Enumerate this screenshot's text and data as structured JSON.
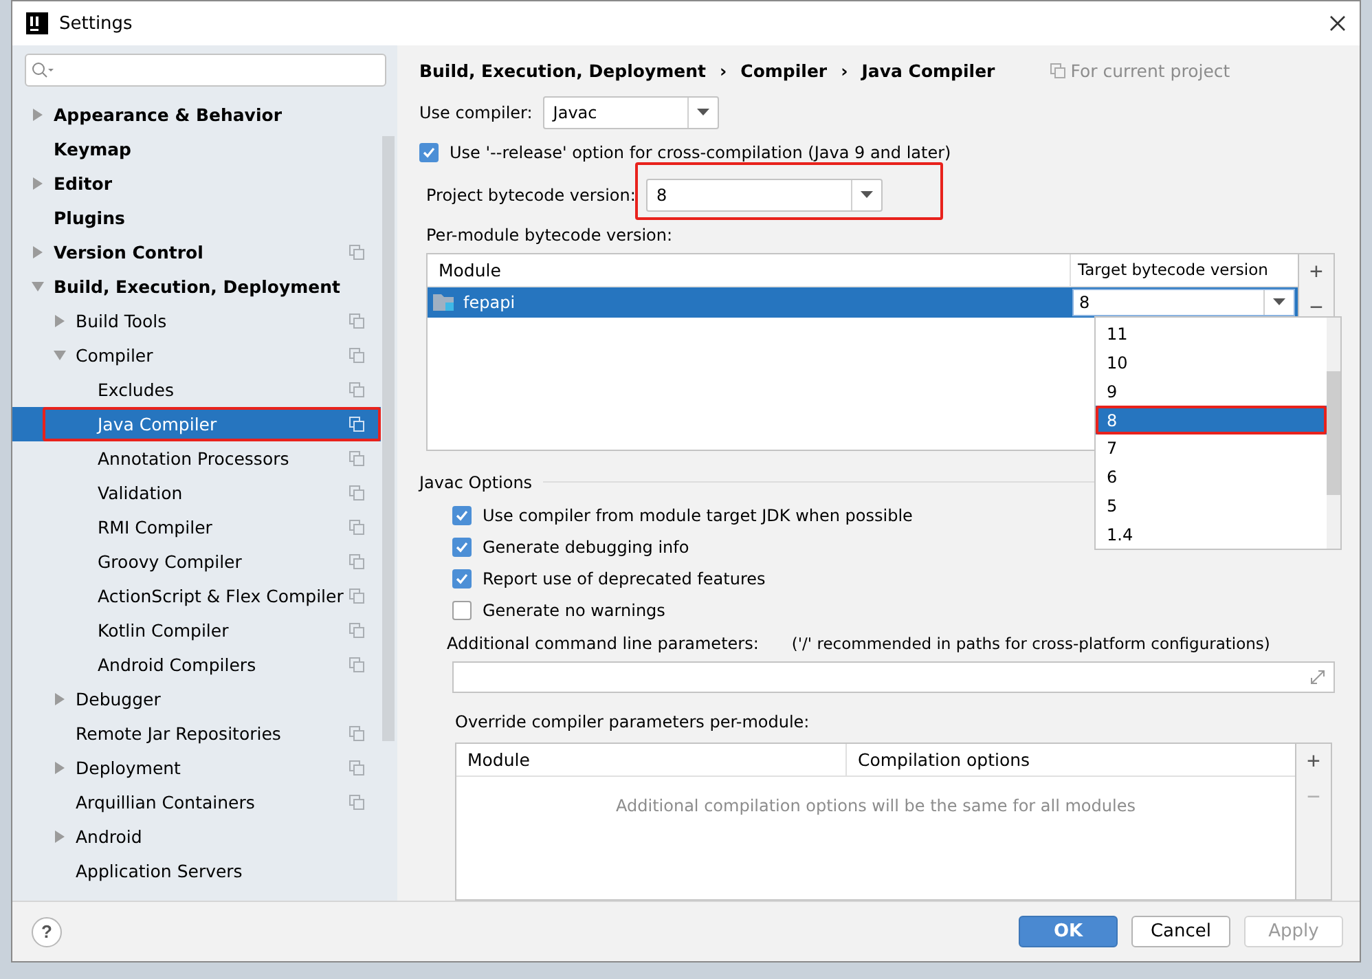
{
  "window": {
    "title": "Settings"
  },
  "sidebar": {
    "items": [
      {
        "label": "Appearance & Behavior",
        "expanded": false,
        "project": false
      },
      {
        "label": "Keymap",
        "project": false
      },
      {
        "label": "Editor",
        "expanded": false,
        "project": false
      },
      {
        "label": "Plugins",
        "project": false
      },
      {
        "label": "Version Control",
        "expanded": false,
        "project": true
      },
      {
        "label": "Build, Execution, Deployment",
        "expanded": true,
        "project": false,
        "children": [
          {
            "label": "Build Tools",
            "expanded": false,
            "project": true
          },
          {
            "label": "Compiler",
            "expanded": true,
            "project": true,
            "children": [
              {
                "label": "Excludes",
                "project": true
              },
              {
                "label": "Java Compiler",
                "project": true,
                "selected": true,
                "highlighted": true
              },
              {
                "label": "Annotation Processors",
                "project": true
              },
              {
                "label": "Validation",
                "project": true
              },
              {
                "label": "RMI Compiler",
                "project": true
              },
              {
                "label": "Groovy Compiler",
                "project": true
              },
              {
                "label": "ActionScript & Flex Compiler",
                "project": true
              },
              {
                "label": "Kotlin Compiler",
                "project": true
              },
              {
                "label": "Android Compilers",
                "project": true
              }
            ]
          },
          {
            "label": "Debugger",
            "expanded": false,
            "project": false
          },
          {
            "label": "Remote Jar Repositories",
            "project": true
          },
          {
            "label": "Deployment",
            "expanded": false,
            "project": true
          },
          {
            "label": "Arquillian Containers",
            "project": true
          },
          {
            "label": "Android",
            "expanded": false,
            "project": false
          },
          {
            "label": "Application Servers",
            "project": false
          }
        ]
      }
    ]
  },
  "breadcrumb": [
    "Build, Execution, Deployment",
    "Compiler",
    "Java Compiler"
  ],
  "breadcrumb_separators": [
    "›",
    "›"
  ],
  "scope_note": "For current project",
  "use_compiler": {
    "label": "Use compiler:",
    "value": "Javac"
  },
  "release_option": {
    "label": "Use '--release' option for cross-compilation (Java 9 and later)",
    "checked": true
  },
  "project_bytecode": {
    "label": "Project bytecode version:",
    "value": "8",
    "highlighted": true
  },
  "per_module": {
    "label": "Per-module bytecode version:",
    "columns": [
      "Module",
      "Target bytecode version"
    ],
    "rows": [
      {
        "module": "fepapi",
        "target": "8",
        "selected": true
      }
    ],
    "add": "+",
    "remove": "−",
    "dropdown": {
      "options": [
        {
          "label": "11",
          "selected": false
        },
        {
          "label": "10",
          "selected": false
        },
        {
          "label": "9",
          "selected": false
        },
        {
          "label": "8",
          "selected": true,
          "highlighted": true
        },
        {
          "label": "7",
          "selected": false
        },
        {
          "label": "6",
          "selected": false
        },
        {
          "label": "5",
          "selected": false
        },
        {
          "label": "1.4",
          "selected": false
        }
      ]
    }
  },
  "javac_options": {
    "title": "Javac Options",
    "checks": [
      {
        "label": "Use compiler from module target JDK when possible",
        "checked": true
      },
      {
        "label": "Generate debugging info",
        "checked": true
      },
      {
        "label": "Report use of deprecated features",
        "checked": true
      },
      {
        "label": "Generate no warnings",
        "checked": false
      }
    ],
    "params_label": "Additional command line parameters:",
    "params_hint": "('/' recommended in paths for cross-platform configurations)",
    "override_label": "Override compiler parameters per-module:",
    "override_columns": [
      "Module",
      "Compilation options"
    ],
    "override_empty": "Additional compilation options will be the same for all modules",
    "add": "+",
    "remove": "−"
  },
  "buttons": [
    {
      "label": "OK",
      "kind": "primary",
      "disabled": false
    },
    {
      "label": "Cancel",
      "kind": "normal",
      "disabled": false
    },
    {
      "label": "Apply",
      "kind": "normal",
      "disabled": true
    }
  ],
  "help": "?"
}
